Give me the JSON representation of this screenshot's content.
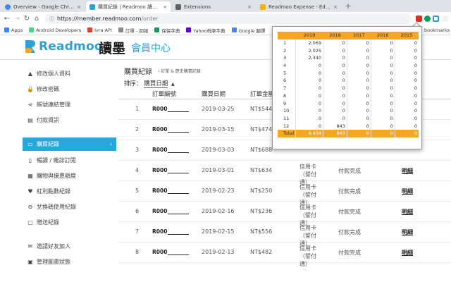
{
  "browser": {
    "tabs": [
      {
        "label": "Overview - Google Chrome",
        "color": "#4285f4",
        "active": false
      },
      {
        "label": "購買紀錄 | Readmoo 讀墨電子書",
        "color": "#2aa1d8",
        "active": true
      },
      {
        "label": "Extensions",
        "color": "#5f6368",
        "active": false
      },
      {
        "label": "Readmoo Expense - Edit Item",
        "color": "#f4b400",
        "active": false
      }
    ],
    "tab_close": "×",
    "new_tab": "+",
    "nav": {
      "back": "←",
      "forward": "→",
      "reload": "↻",
      "home": "⌂"
    },
    "url_host": "https://member.readmoo.com",
    "url_path": "/order",
    "lock": "ⓘ",
    "bookmarks": [
      {
        "label": "Apps",
        "color": "#4285f4"
      },
      {
        "label": "Android Developers",
        "color": "#3ddc84"
      },
      {
        "label": "Ivra API",
        "color": "#db4437"
      },
      {
        "label": "訂單 - 回報",
        "color": "#888888"
      },
      {
        "label": "保保字典",
        "color": "#0f9d58"
      },
      {
        "label": "Yahoo奇摩字典",
        "color": "#6001d2"
      },
      {
        "label": "Google 翻譯",
        "color": "#4285f4"
      },
      {
        "label": "天",
        "color": "#34a853"
      }
    ],
    "bookmarks_more": "bookmarks"
  },
  "header": {
    "logo_text": "Readmoo",
    "logo_cn": "讀墨",
    "subtitle": "會員中心"
  },
  "sidebar": {
    "items": [
      {
        "label": "修改個人資料",
        "icon": "▲"
      },
      {
        "label": "修改密碼",
        "icon": "🔒"
      },
      {
        "label": "帳號連結管理",
        "icon": "⋖"
      },
      {
        "label": "付款資訊",
        "icon": "▤"
      },
      {
        "label": "購買紀錄",
        "icon": "▭",
        "active": true
      },
      {
        "label": "暢讀 / 雜誌訂閱",
        "icon": "▯"
      },
      {
        "label": "購物與優惠額度",
        "icon": "▦"
      },
      {
        "label": "紅利點數紀錄",
        "icon": "♥"
      },
      {
        "label": "兌換碼使用紀錄",
        "icon": "⊖"
      },
      {
        "label": "贈送紀錄",
        "icon": "▢"
      },
      {
        "label": "邀請好友加入",
        "icon": "✉"
      },
      {
        "label": "管理圖書狀態",
        "icon": "▣"
      }
    ],
    "chevron": "›"
  },
  "main": {
    "title": "購買紀錄",
    "breadcrumb": "› 訂單 & 歷史購書記錄",
    "sort_label": "排序：",
    "sort_value": "購買日期",
    "sort_caret": "▲",
    "columns": [
      "訂單編號",
      "購買日期",
      "訂單金額"
    ],
    "rows": [
      {
        "idx": "1",
        "order": "R000",
        "date": "2019-03-25",
        "amount": "NT$544",
        "pay": "",
        "status": "",
        "detail": ""
      },
      {
        "idx": "2",
        "order": "R000",
        "date": "2019-03-15",
        "amount": "NT$474",
        "pay": "",
        "status": "",
        "detail": ""
      },
      {
        "idx": "3",
        "order": "R000",
        "date": "2019-03-03",
        "amount": "NT$688",
        "pay": "",
        "status": "",
        "detail": ""
      },
      {
        "idx": "4",
        "order": "R000",
        "date": "2019-03-01",
        "amount": "NT$634",
        "pay": "信用卡（譬付通）",
        "status": "付款完成",
        "detail": "明細"
      },
      {
        "idx": "5",
        "order": "R000",
        "date": "2019-02-23",
        "amount": "NT$250",
        "pay": "信用卡（譬付通）",
        "status": "付款完成",
        "detail": "明細"
      },
      {
        "idx": "6",
        "order": "R000",
        "date": "2019-02-16",
        "amount": "NT$236",
        "pay": "信用卡（譬付通）",
        "status": "付款完成",
        "detail": "明細"
      },
      {
        "idx": "7",
        "order": "R000",
        "date": "2019-02-15",
        "amount": "NT$556",
        "pay": "信用卡（譬付通）",
        "status": "付款完成",
        "detail": "明細"
      },
      {
        "idx": "8",
        "order": "R000",
        "date": "2019-02-13",
        "amount": "NT$482",
        "pay": "信用卡（譬付通）",
        "status": "付款完成",
        "detail": "明細"
      }
    ]
  },
  "popup": {
    "header_color": "#f5a623",
    "years": [
      "2019",
      "2018",
      "2017",
      "2016",
      "2015"
    ],
    "months": [
      {
        "m": "1",
        "v": [
          "2,069",
          "0",
          "0",
          "0",
          "0"
        ]
      },
      {
        "m": "2",
        "v": [
          "2,025",
          "0",
          "0",
          "0",
          "0"
        ]
      },
      {
        "m": "3",
        "v": [
          "2,340",
          "0",
          "0",
          "0",
          "0"
        ]
      },
      {
        "m": "4",
        "v": [
          "0",
          "0",
          "0",
          "0",
          "0"
        ]
      },
      {
        "m": "5",
        "v": [
          "0",
          "0",
          "0",
          "0",
          "0"
        ]
      },
      {
        "m": "6",
        "v": [
          "0",
          "0",
          "0",
          "0",
          "0"
        ]
      },
      {
        "m": "7",
        "v": [
          "0",
          "0",
          "0",
          "0",
          "0"
        ]
      },
      {
        "m": "8",
        "v": [
          "0",
          "0",
          "0",
          "0",
          "0"
        ]
      },
      {
        "m": "9",
        "v": [
          "0",
          "0",
          "0",
          "0",
          "0"
        ]
      },
      {
        "m": "10",
        "v": [
          "0",
          "0",
          "0",
          "0",
          "0"
        ]
      },
      {
        "m": "11",
        "v": [
          "0",
          "0",
          "0",
          "0",
          "0"
        ]
      },
      {
        "m": "12",
        "v": [
          "0",
          "843",
          "0",
          "0",
          "0"
        ]
      }
    ],
    "total_label": "Total",
    "totals": [
      "6,434",
      "843",
      "0",
      "0",
      "0"
    ]
  }
}
